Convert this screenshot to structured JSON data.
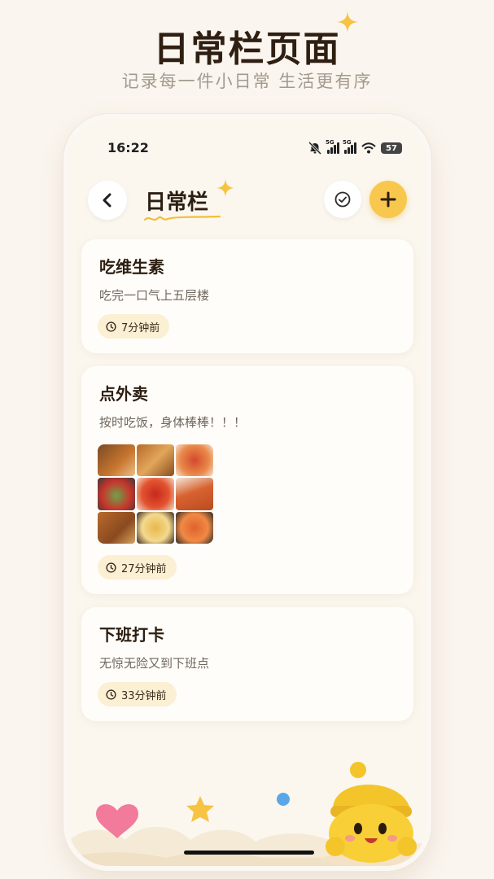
{
  "promo": {
    "title": "日常栏页面",
    "subtitle": "记录每一件小日常 生活更有序"
  },
  "status_bar": {
    "time": "16:22",
    "signal1_label": "5G",
    "signal2_label": "5G",
    "battery": "57"
  },
  "header": {
    "title": "日常栏",
    "back_icon": "chevron-left-icon",
    "check_icon": "check-circle-icon",
    "add_icon": "plus-icon"
  },
  "entries": [
    {
      "title": "吃维生素",
      "description": "吃完一口气上五层楼",
      "time": "7分钟前",
      "has_image": false
    },
    {
      "title": "点外卖",
      "description": "按时吃饭，身体棒棒！！！",
      "time": "27分钟前",
      "has_image": true
    },
    {
      "title": "下班打卡",
      "description": "无惊无险又到下班点",
      "time": "33分钟前",
      "has_image": false
    }
  ],
  "colors": {
    "accent": "#f8c84e",
    "background": "#faf5ee",
    "badge": "#fbefd4",
    "title_text": "#2d1e12"
  }
}
